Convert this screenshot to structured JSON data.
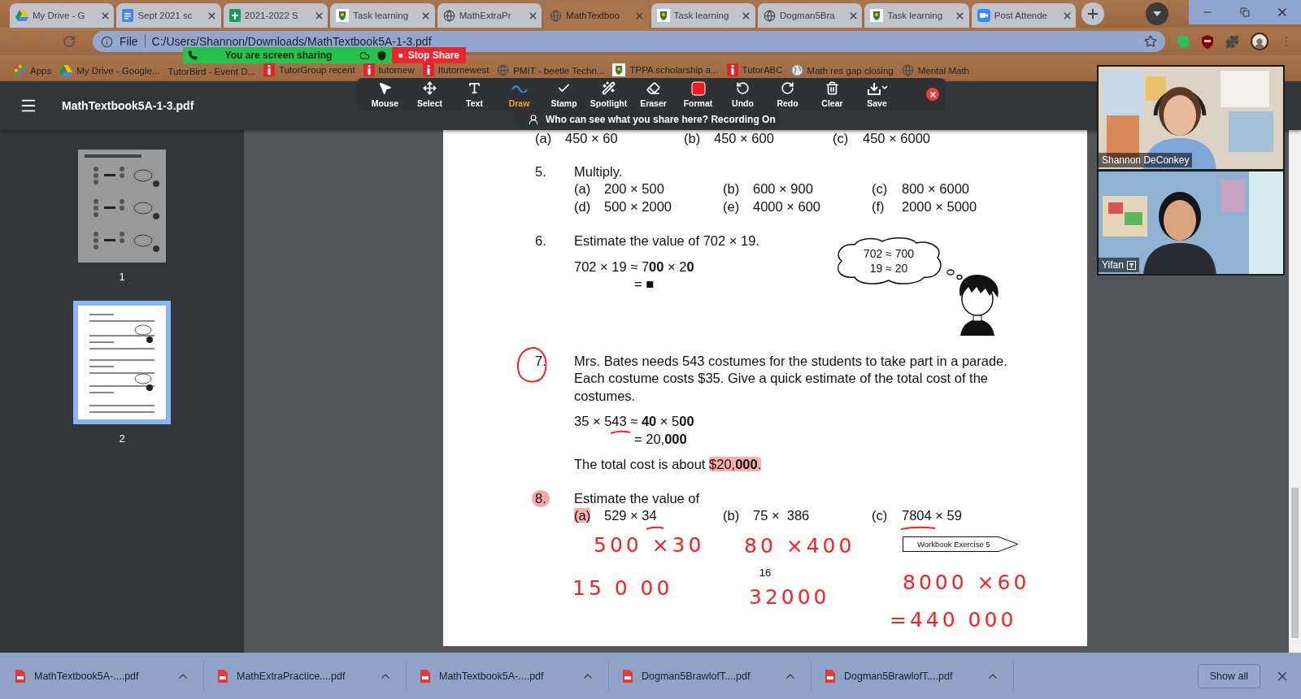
{
  "tabs": [
    {
      "title": "My Drive - G",
      "kind": "drive",
      "selected": false
    },
    {
      "title": "Sept 2021 sc",
      "kind": "docs",
      "selected": false
    },
    {
      "title": "2021-2022 S",
      "kind": "sheets",
      "selected": false
    },
    {
      "title": "Task learning",
      "kind": "crest",
      "selected": false
    },
    {
      "title": "MathExtraPr",
      "kind": "globe",
      "selected": false
    },
    {
      "title": "MathTextboo",
      "kind": "globe",
      "selected": true
    },
    {
      "title": "Task learning",
      "kind": "crest",
      "selected": false
    },
    {
      "title": "Dogman5Bra",
      "kind": "globe",
      "selected": false
    },
    {
      "title": "Task learning",
      "kind": "crest",
      "selected": false
    },
    {
      "title": "Post Attende",
      "kind": "video",
      "selected": false
    }
  ],
  "address_bar": {
    "scheme": "File",
    "url": "C:/Users/Shannon/Downloads/MathTextbook5A-1-3.pdf"
  },
  "bookmarks": [
    {
      "label": "Apps",
      "kind": "apps"
    },
    {
      "label": "My Drive - Google...",
      "kind": "drive"
    },
    {
      "label": "TutorBird - Event D...",
      "kind": "none"
    },
    {
      "label": "TutorGroup recent",
      "kind": "info"
    },
    {
      "label": "tutornew",
      "kind": "info"
    },
    {
      "label": "Itutornewest",
      "kind": "info"
    },
    {
      "label": "PMIT - beetle Techn...",
      "kind": "globe"
    },
    {
      "label": "TPPA scholarship a...",
      "kind": "crest"
    },
    {
      "label": "TutorABC",
      "kind": "info"
    },
    {
      "label": "Math res gap closing",
      "kind": "world"
    },
    {
      "label": "Mental Math",
      "kind": "globe"
    }
  ],
  "share_banner": {
    "status": "You are screen sharing",
    "stop": "Stop Share"
  },
  "annotate_toolbar": {
    "tools": [
      {
        "label": "Mouse",
        "kind": "pointer",
        "selected": false
      },
      {
        "label": "Select",
        "kind": "move",
        "selected": false
      },
      {
        "label": "Text",
        "kind": "text",
        "selected": false
      },
      {
        "label": "Draw",
        "kind": "draw",
        "selected": true
      },
      {
        "label": "Stamp",
        "kind": "check",
        "selected": false
      },
      {
        "label": "Spotlight",
        "kind": "wand",
        "selected": false
      },
      {
        "label": "Eraser",
        "kind": "eraser",
        "selected": false
      },
      {
        "label": "Format",
        "kind": "format",
        "selected": false
      },
      {
        "label": "Undo",
        "kind": "undo",
        "selected": false
      },
      {
        "label": "Redo",
        "kind": "redo",
        "selected": false
      },
      {
        "label": "Clear",
        "kind": "trash",
        "selected": false
      },
      {
        "label": "Save",
        "kind": "save",
        "selected": false
      }
    ],
    "notice": "Who can see what you share here? Recording On"
  },
  "viewer": {
    "title": "MathTextbook5A-1-3.pdf",
    "thumbnails": [
      {
        "label": "1",
        "kind": "dots",
        "selected": false
      },
      {
        "label": "2",
        "kind": "text",
        "selected": true
      }
    ]
  },
  "page": {
    "top_parts": [
      {
        "label": "(a)",
        "expr": "450 × 60"
      },
      {
        "label": "(b)",
        "expr": "450 × 600"
      },
      {
        "label": "(c)",
        "expr": "450 × 6000"
      }
    ],
    "questions": [
      {
        "number": "5.",
        "prompt": "Multiply.",
        "circled": false,
        "highlighted": false,
        "parts": [
          {
            "label": "(a)",
            "expr": "200 × 500"
          },
          {
            "label": "(b)",
            "expr": "600 × 900"
          },
          {
            "label": "(c)",
            "expr": "800 × 6000"
          },
          {
            "label": "(d)",
            "expr": "500 × 2000"
          },
          {
            "label": "(e)",
            "expr": "4000 × 600"
          },
          {
            "label": "(f)",
            "expr": "2000 × 5000"
          }
        ]
      },
      {
        "number": "6.",
        "prompt": "Estimate the value of 702 × 19.",
        "circled": false,
        "highlighted": false,
        "lines": [
          "702 × 19 ≈ 7**00** × 2**0**",
          "= ■"
        ],
        "thought": [
          "702 ≈ 700",
          "19 ≈ 20"
        ]
      },
      {
        "number": "7.",
        "prompt": "Mrs. Bates needs 543 costumes for the students to take part in a parade. Each costume costs $35. Give a quick estimate of the total cost of the costumes.",
        "circled": true,
        "highlighted": false,
        "lines": [
          "35 × 543 ≈ **40** × 5**00**",
          "= 20,**000**"
        ],
        "answer": {
          "lead": "The total cost is about",
          "highlighted": "$20,**000**."
        }
      },
      {
        "number": "8.",
        "prompt": "Estimate the value of",
        "circled": false,
        "highlighted": true,
        "parts": [
          {
            "label": "(a)",
            "expr": "529 × 34",
            "highlighted": true
          },
          {
            "label": "(b)",
            "expr": "75 ×  386",
            "highlighted": false
          },
          {
            "label": "(c)",
            "expr": "7804 × 59",
            "highlighted": false
          }
        ]
      }
    ],
    "workbook": "Workbook Exercise 5",
    "page_number": "16",
    "ink_notes": [
      "500 ×30",
      "80 ×400",
      "15 0 00",
      "32000",
      "8000 ×60",
      "=440 000"
    ]
  },
  "participants": [
    {
      "name": "Shannon DeConkey",
      "badge": false
    },
    {
      "name": "Yifan",
      "badge": true
    }
  ],
  "downloads": {
    "files": [
      "MathTextbook5A-....pdf",
      "MathExtraPractice....pdf",
      "MathTextbook5A-....pdf",
      "Dogman5BrawlofT....pdf",
      "Dogman5BrawlofT....pdf"
    ],
    "show_all": "Show all"
  }
}
